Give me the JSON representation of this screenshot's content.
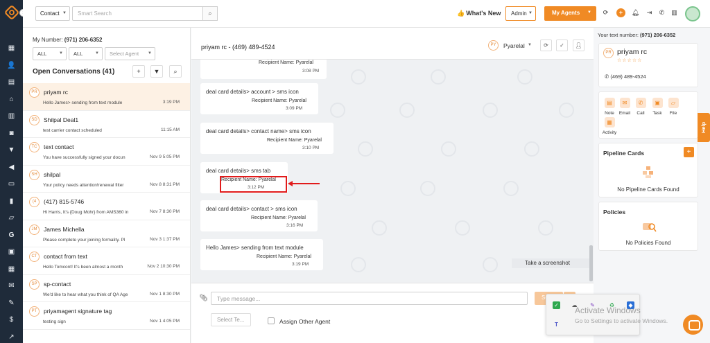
{
  "topbar": {
    "contact_select": "Contact",
    "search_placeholder": "Smart Search",
    "whats_new": "What's New",
    "admin_select": "Admin",
    "my_agents": "My Agents"
  },
  "left": {
    "my_number_label": "My Number:",
    "my_number": "(971) 206-6352",
    "filter1": "ALL",
    "filter2": "ALL",
    "agent_placeholder": "Select Agent",
    "open_conversations": "Open Conversations (41)",
    "conversations": [
      {
        "initials": "PR",
        "name": "priyam rc",
        "preview": "Hello James> sending from text module",
        "time": "3:19 PM"
      },
      {
        "initials": "SD",
        "name": "Shilpal Deal1",
        "preview": "test carrier contact scheduled",
        "time": "11:15 AM"
      },
      {
        "initials": "TC",
        "name": "text contact",
        "preview": "You have successfully signed your docun",
        "time": "Nov 9 5:05 PM"
      },
      {
        "initials": "SH",
        "name": "shilpal",
        "preview": "Your policy needs attention!renewal filter",
        "time": "Nov 8 8:31 PM"
      },
      {
        "initials": "(4",
        "name": "(417) 815-5746",
        "preview": "Hi Harris, It's {Doug Mohr} from AMS360 in",
        "time": "Nov 7 8:30 PM"
      },
      {
        "initials": "JM",
        "name": "James Michella",
        "preview": "Please complete your joining formality. Pl",
        "time": "Nov 3 1:37 PM"
      },
      {
        "initials": "CT",
        "name": "contact from text",
        "preview": "Hello Tomcont! It's been almost a month",
        "time": "Nov 2 10:30 PM"
      },
      {
        "initials": "SP",
        "name": "sp-contact",
        "preview": "We'd like to hear what you think of QA Age",
        "time": "Nov 1 8:30 PM"
      },
      {
        "initials": "PT",
        "name": "priyamagent signature tag",
        "preview": "testing sign",
        "time": "Nov 1 4:05 PM"
      }
    ]
  },
  "chat": {
    "title": "priyam rc - (469) 489-4524",
    "agent_initials": "PY",
    "agent_name": "Pyarelal",
    "messages": [
      {
        "text": "",
        "recipient": "Recipient Name: Pyarelal",
        "time": "3:08 PM"
      },
      {
        "text": "deal card details> account > sms icon",
        "recipient": "Recipient Name: Pyarelal",
        "time": "3:09 PM"
      },
      {
        "text": "deal card details> contact name> sms icon",
        "recipient": "Recipient Name: Pyarelal",
        "time": "3:10 PM"
      },
      {
        "text": "deal card details> sms tab",
        "recipient": "Recipient Name: Pyarelal",
        "time": "3:12 PM"
      },
      {
        "text": "deal card details> contact > sms icon",
        "recipient": "Recipient Name: Pyarelal",
        "time": "3:16 PM"
      },
      {
        "text": "Hello James> sending from text module",
        "recipient": "Recipient Name: Pyarelal",
        "time": "3:19 PM"
      }
    ],
    "screenshot_tooltip": "Take a screenshot",
    "input_placeholder": "Type message...",
    "send_label": "Send",
    "template_placeholder": "Select Te...",
    "assign_label": "Assign Other Agent"
  },
  "right": {
    "your_text_label": "Your text number:",
    "your_text_number": "(971) 206-6352",
    "profile_initials": "PR",
    "profile_name": "priyam rc",
    "stars": "☆☆☆☆☆",
    "profile_phone": "(469) 489-4524",
    "actions": [
      "Note",
      "Email",
      "Call",
      "Task",
      "File",
      "Activity"
    ],
    "pipeline_title": "Pipeline Cards",
    "pipeline_empty": "No Pipeline Cards Found",
    "policies_title": "Policies",
    "policies_empty": "No Policies Found",
    "help_tab": "Help"
  },
  "overlay": {
    "activate_title": "Activate Windows",
    "activate_sub": "Go to Settings to activate Windows."
  },
  "colors": {
    "accent": "#f08a24",
    "rail": "#1f2b3a",
    "highlight": "#e11b1b"
  }
}
